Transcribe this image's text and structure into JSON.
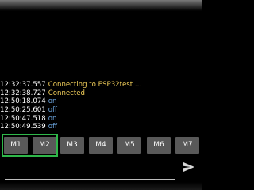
{
  "log": [
    {
      "time": "12:32:37.557",
      "text": "Connecting to ESP32test ...",
      "kind": "status"
    },
    {
      "time": "12:32:38.727",
      "text": "Connected",
      "kind": "status"
    },
    {
      "time": "12:50:18.074",
      "text": "on",
      "kind": "data"
    },
    {
      "time": "12:50:25.601",
      "text": "off",
      "kind": "data"
    },
    {
      "time": "12:50:47.518",
      "text": "on",
      "kind": "data"
    },
    {
      "time": "12:50:49.539",
      "text": "off",
      "kind": "data"
    }
  ],
  "macros": [
    "M1",
    "M2",
    "M3",
    "M4",
    "M5",
    "M6",
    "M7"
  ],
  "input": {
    "value": "",
    "placeholder": ""
  },
  "send": {
    "icon": "send-icon"
  },
  "colors": {
    "status": "#f3cf5a",
    "data": "#6aa4de",
    "highlight": "#2fb74a",
    "button": "#595959"
  }
}
